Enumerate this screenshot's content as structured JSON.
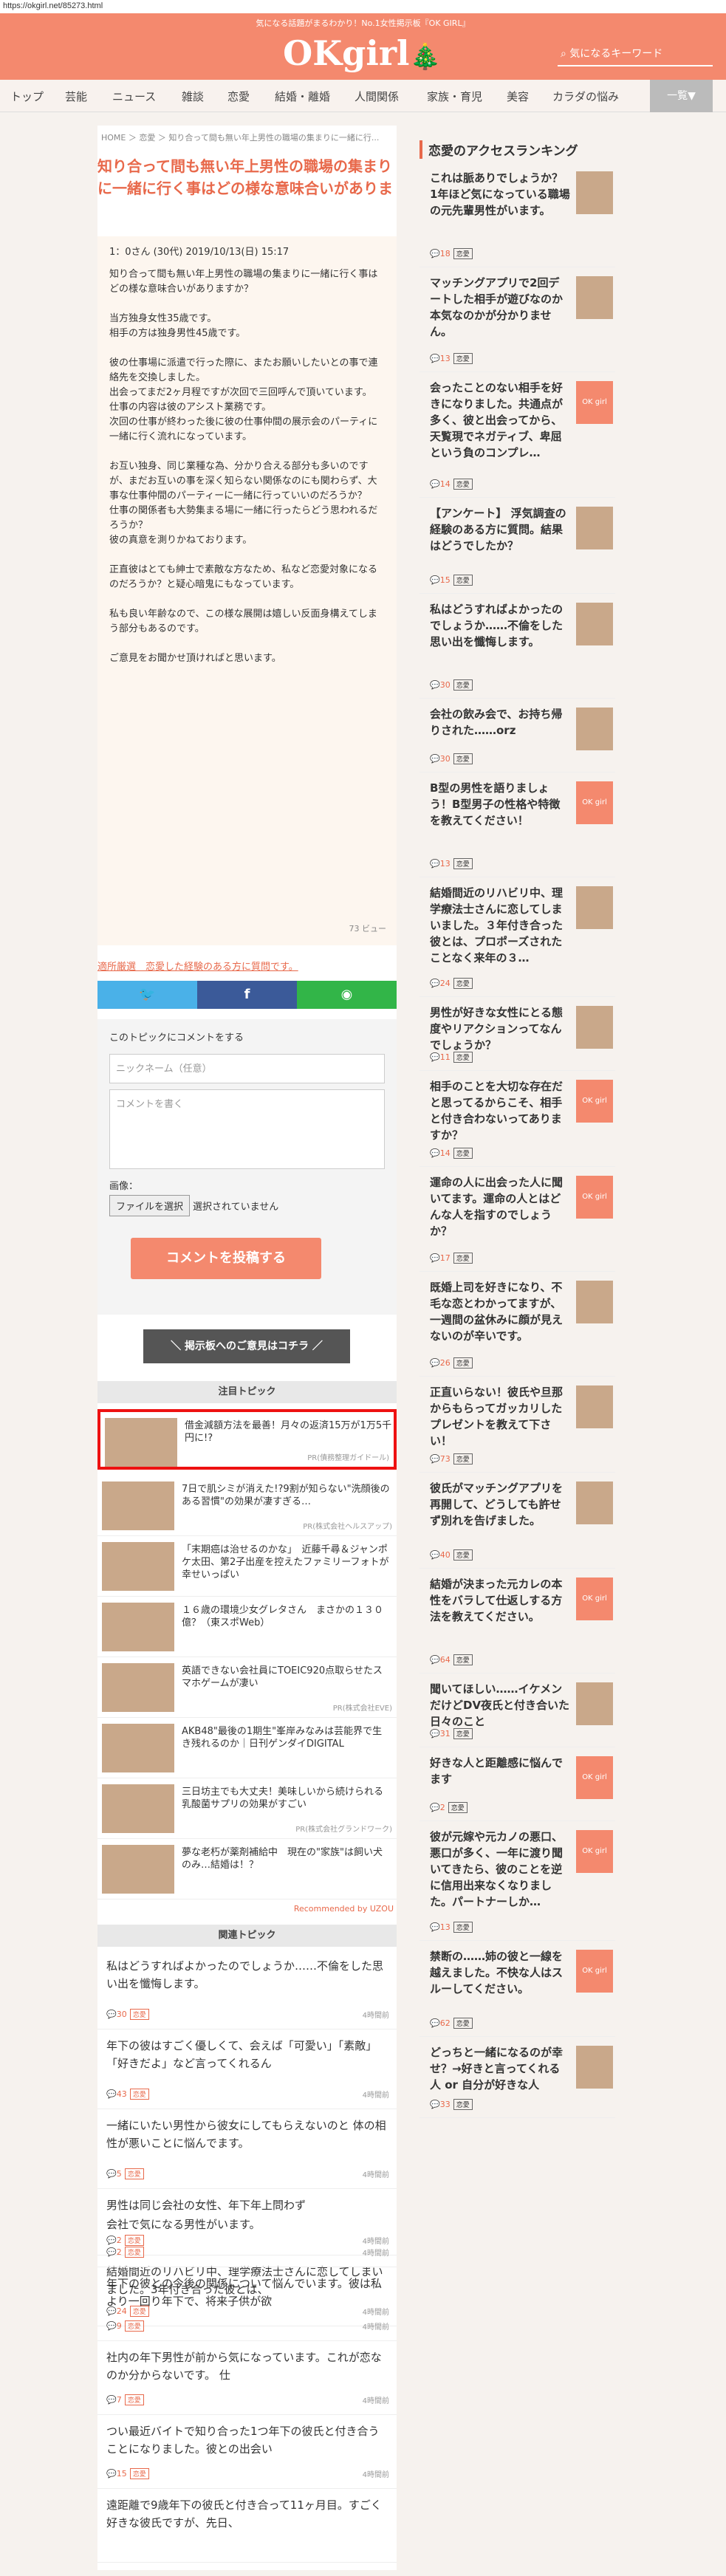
{
  "url": "https://okgirl.net/85273.html",
  "header": {
    "tagline": "気になる話題がまるわかり！No.1女性掲示板『OK GIRL』",
    "logo": "OKgirl",
    "search_placeholder": "気になるキーワード"
  },
  "nav": {
    "items": [
      "トップ",
      "芸能",
      "ニュース",
      "雑談",
      "恋愛",
      "結婚・離婚",
      "人間関係",
      "家族・育児",
      "美容",
      "カラダの悩み"
    ],
    "more": "一覧▼"
  },
  "breadcrumb": [
    "HOME",
    "恋愛",
    "知り合って間も無い年上男性の職場の集まりに一緒に行..."
  ],
  "title": "知り合って間も無い年上男性の職場の集まりに一緒に行く事はどの様な意味合いがありま",
  "post": {
    "meta": "1：0さん (30代) 2019/10/13(日) 15:17",
    "paragraphs": [
      "知り合って間も無い年上男性の職場の集まりに一緒に行く事はどの様な意味合いがありますか？",
      "当方独身女性35歳です。\n相手の方は独身男性45歳です。",
      "彼の仕事場に派遣で行った際に、またお願いしたいとの事で連絡先を交換しました。\n出会ってまだ2ヶ月程ですが次回で三回呼んで頂いています。\n仕事の内容は彼のアシスト業務です。\n次回の仕事が終わった後に彼の仕事仲間の展示会のパーティに一緒に行く流れになっています。",
      "お互い独身、同じ業種な為、分かり合える部分も多いのですが、まだお互いの事を深く知らない関係なのにも関わらず、大事な仕事仲間のパーティーに一緒に行っていいのだろうか？\n仕事の関係者も大勢集まる場に一緒に行ったらどう思われるだろうか？\n彼の真意を測りかねております。",
      "正直彼はとても紳士で素敵な方なため、私など恋愛対象になるのだろうか？と疑心暗鬼にもなっています。",
      "私も良い年齢なので、この様な展開は嬉しい反面身構えてしまう部分もあるのです。",
      "ご意見をお聞かせ頂ければと思います。"
    ],
    "views": "73 ビュー"
  },
  "report_link": "適所厳選　恋愛した経験のある方に質問です。",
  "comment_form": {
    "heading": "このトピックにコメントをする",
    "name_placeholder": "ニックネーム（任意）",
    "body_placeholder": "コメントを書く",
    "image_label": "画像：",
    "file_button": "ファイルを選択",
    "file_status": "選択されていません",
    "submit": "コメントを投稿する"
  },
  "opinion_button": "＼ 掲示板へのご意見はコチラ ／",
  "featured_heading": "注目トピック",
  "featured": [
    {
      "title": "借金減額方法を最善！月々の返済15万が1万5千円に!?",
      "source": "PR(債務整理ガイドール)"
    },
    {
      "title": "7日で肌シミが消えた!?9割が知らない\"洗顔後のある習慣\"の効果が凄すぎる…",
      "source": "PR(株式会社ヘルスアップ)"
    },
    {
      "title": "「末期癌は治せるのかな」　近藤千尋＆ジャンポケ太田、第2子出産を控えたファミリーフォトが幸せいっぱい",
      "source": ""
    },
    {
      "title": "１６歳の環境少女グレタさん　まさかの１３０億？（東スポWeb）",
      "source": ""
    },
    {
      "title": "英語できない会社員にTOEIC920点取らせたスマホゲームが凄い",
      "source": "PR(株式会社EVE)"
    },
    {
      "title": "AKB48\"最後の1期生\"峯岸みなみは芸能界で生き残れるのか｜日刊ゲンダイDIGITAL",
      "source": ""
    },
    {
      "title": "三日坊主でも大丈夫！美味しいから続けられる乳酸菌サプリの効果がすごい",
      "source": "PR(株式会社グランドワーク)"
    },
    {
      "title": "夢な老朽が薬剤補給中　現在の\"家族\"は飼い犬のみ…結婚は！？",
      "source": ""
    }
  ],
  "recommended_by": "Recommended by UZOU",
  "related_heading": "関連トピック",
  "related": [
    {
      "title": "私はどうすればよかったのでしょうか……不倫をした思い出を懺悔します。",
      "count": "30",
      "tag": "恋愛",
      "ago": "4時間前"
    },
    {
      "title": "年下の彼はすごく優しくて、会えば「可愛い」「素敵」「好きだよ」など言ってくれるん",
      "count": "43",
      "tag": "恋愛",
      "ago": "4時間前"
    },
    {
      "title": "一緒にいたい男性から彼女にしてもらえないのと 体の相性が悪いことに悩んでます。",
      "count": "5",
      "tag": "恋愛",
      "ago": "4時間前"
    },
    {
      "title": "男性は同じ会社の女性、年下年上問わず",
      "count": "2",
      "tag": "恋愛",
      "ago": "4時間前"
    },
    {
      "title": "結婚間近のリハビリ中、理学療法士さんに恋してしまいました。3年付き合った彼とは、",
      "count": "24",
      "tag": "恋愛",
      "ago": "4時間前"
    },
    {
      "title": "会社で気になる男性がいます。",
      "count": "2",
      "tag": "恋愛",
      "ago": "4時間前"
    },
    {
      "title": "年下の彼との今後の関係について悩んでいます。彼は私より一回り年下で、将来子供が欲",
      "count": "9",
      "tag": "恋愛",
      "ago": "4時間前"
    },
    {
      "title": "社内の年下男性が前から気になっています。これが恋なのか分からないです。 仕",
      "count": "7",
      "tag": "恋愛",
      "ago": "4時間前"
    },
    {
      "title": "つい最近バイトで知り合った1つ年下の彼氏と付き合うことになりました。彼との出会い",
      "count": "15",
      "tag": "恋愛",
      "ago": "4時間前"
    },
    {
      "title": "遠距離で9歳年下の彼氏と付き合って11ヶ月目。すごく好きな彼氏ですが、先日、",
      "count": "",
      "tag": "",
      "ago": ""
    }
  ],
  "sidebar_heading": "恋愛のアクセスランキング",
  "ranking": [
    {
      "title": "これは脈ありでしょうか？1年ほど気になっている職場の元先輩男性がいます。",
      "count": "18",
      "tag": "恋愛"
    },
    {
      "title": "マッチングアプリで2回デートした相手が遊びなのか本気なのかが分かりません。",
      "count": "13",
      "tag": "恋愛"
    },
    {
      "title": "会ったことのない相手を好きになりました。共通点が多く、彼と出会ってから、天覧現でネガティブ、卑屈という負のコンプレ…",
      "count": "14",
      "tag": "恋愛"
    },
    {
      "title": "【アンケート】 浮気調査の経験のある方に質問。結果はどうでしたか？",
      "count": "15",
      "tag": "恋愛"
    },
    {
      "title": "私はどうすればよかったのでしょうか……不倫をした思い出を懺悔します。",
      "count": "30",
      "tag": "恋愛"
    },
    {
      "title": "会社の飲み会で、お持ち帰りされた……orz",
      "count": "30",
      "tag": "恋愛"
    },
    {
      "title": "B型の男性を語りましょう！B型男子の性格や特徴を教えてください！",
      "count": "13",
      "tag": "恋愛"
    },
    {
      "title": "結婚間近のリハビリ中、理学療法士さんに恋してしまいました。３年付き合った彼とは、プロポーズされたことなく来年の３…",
      "count": "24",
      "tag": "恋愛"
    },
    {
      "title": "男性が好きな女性にとる態度やリアクションってなんでしょうか？",
      "count": "11",
      "tag": "恋愛"
    },
    {
      "title": "相手のことを大切な存在だと思ってるからこそ、相手と付き合わないってありますか？",
      "count": "14",
      "tag": "恋愛"
    },
    {
      "title": "運命の人に出会った人に聞いてます。運命の人とはどんな人を指すのでしょうか？",
      "count": "17",
      "tag": "恋愛"
    },
    {
      "title": "既婚上司を好きになり、不毛な恋とわかってますが、一週間の盆休みに顔が見えないのが辛いです。",
      "count": "26",
      "tag": "恋愛"
    },
    {
      "title": "正直いらない！彼氏や旦那からもらってガッカリしたプレゼントを教えて下さい！",
      "count": "73",
      "tag": "恋愛"
    },
    {
      "title": "彼氏がマッチングアプリを再開して、どうしても許せず別れを告げました。",
      "count": "40",
      "tag": "恋愛"
    },
    {
      "title": "結婚が決まった元カレの本性をバラして仕返しする方法を教えてください。",
      "count": "64",
      "tag": "恋愛"
    },
    {
      "title": "聞いてほしい……イケメンだけどDV夜氏と付き合いた日々のこと",
      "count": "31",
      "tag": "恋愛"
    },
    {
      "title": "好きな人と距離感に悩んでます",
      "count": "2",
      "tag": "恋愛"
    },
    {
      "title": "彼が元嫁や元カノの悪口、悪口が多く、一年に渡り聞いてきたら、彼のことを逆に信用出来なくなりました。パートナーしか…",
      "count": "13",
      "tag": "恋愛"
    },
    {
      "title": "禁断の……姉の彼と一線を越えました。不快な人はスルーしてください。",
      "count": "62",
      "tag": "恋愛"
    },
    {
      "title": "どっちと一緒になるのが幸せ？→好きと言ってくれる人 or 自分が好きな人",
      "count": "33",
      "tag": "恋愛"
    }
  ]
}
